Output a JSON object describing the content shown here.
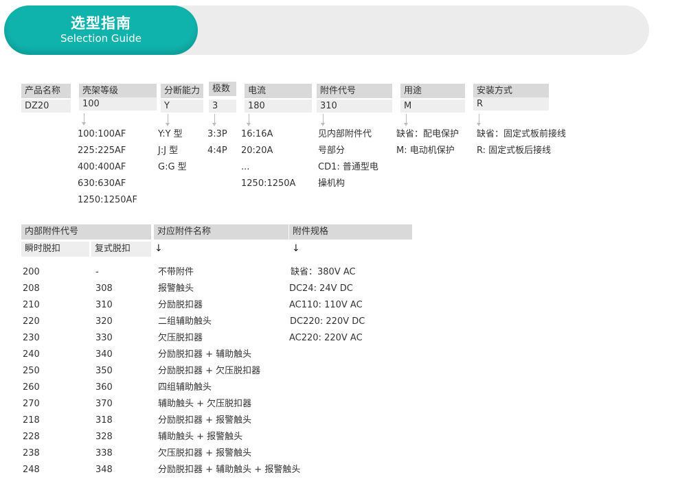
{
  "banner": {
    "title_cn": "选型指南",
    "title_en": "Selection Guide"
  },
  "model_code": {
    "groups": [
      {
        "header": "产品名称",
        "value": "DZ20",
        "options": []
      },
      {
        "header": "壳架等级",
        "value": "100",
        "options": [
          "100:100AF",
          "225:225AF",
          "400:400AF",
          "630:630AF",
          "1250:1250AF"
        ]
      },
      {
        "header": "分断能力",
        "value": "Y",
        "options": [
          "Y:Y 型",
          "J:J 型",
          "G:G 型"
        ]
      },
      {
        "header": "极数",
        "value": "3",
        "options": [
          "3:3P",
          "4:4P"
        ]
      },
      {
        "header": "电流",
        "value": "180",
        "options": [
          "16:16A",
          "20:20A",
          "...",
          "1250:1250A"
        ]
      },
      {
        "header": "附件代号",
        "value": "310",
        "options": [
          "见内部附件代",
          "号部分",
          "CD1: 普通型电",
          "操机构"
        ]
      },
      {
        "header": "用途",
        "value": "M",
        "options": [
          "缺省：配电保护",
          "M: 电动机保护"
        ]
      },
      {
        "header": "安装方式",
        "value": "R",
        "options": [
          "缺省：固定式板前接线",
          "R: 固定式板后接线"
        ]
      }
    ]
  },
  "accessory_table": {
    "header_code": "内部附件代号",
    "sub_instant": "瞬时脱扣",
    "sub_compound": "复式脱扣",
    "header_name": "对应附件名称",
    "header_spec": "附件规格",
    "arrow": "↓",
    "rows": [
      [
        "200",
        "-",
        "不带附件"
      ],
      [
        "208",
        "308",
        "报警触头"
      ],
      [
        "210",
        "310",
        "分励脱扣器"
      ],
      [
        "220",
        "320",
        "二组辅助触头"
      ],
      [
        "230",
        "330",
        "欠压脱扣器"
      ],
      [
        "240",
        "340",
        "分励脱扣器 + 辅助触头"
      ],
      [
        "250",
        "350",
        "分励脱扣器 + 欠压脱扣器"
      ],
      [
        "260",
        "360",
        "四组辅助触头"
      ],
      [
        "270",
        "370",
        "辅助触头 + 欠压脱扣器"
      ],
      [
        "218",
        "318",
        "分励脱扣器 + 报警触头"
      ],
      [
        "228",
        "328",
        "辅助触头 + 报警触头"
      ],
      [
        "238",
        "338",
        "欠压脱扣器 + 报警触头"
      ],
      [
        "248",
        "348",
        "分励脱扣器 + 辅助触头 + 报警触头"
      ]
    ],
    "specs": [
      "缺省：380V AC",
      "DC24: 24V DC",
      "AC110: 110V AC",
      "DC220: 220V DC",
      "AC220: 220V AC"
    ]
  }
}
